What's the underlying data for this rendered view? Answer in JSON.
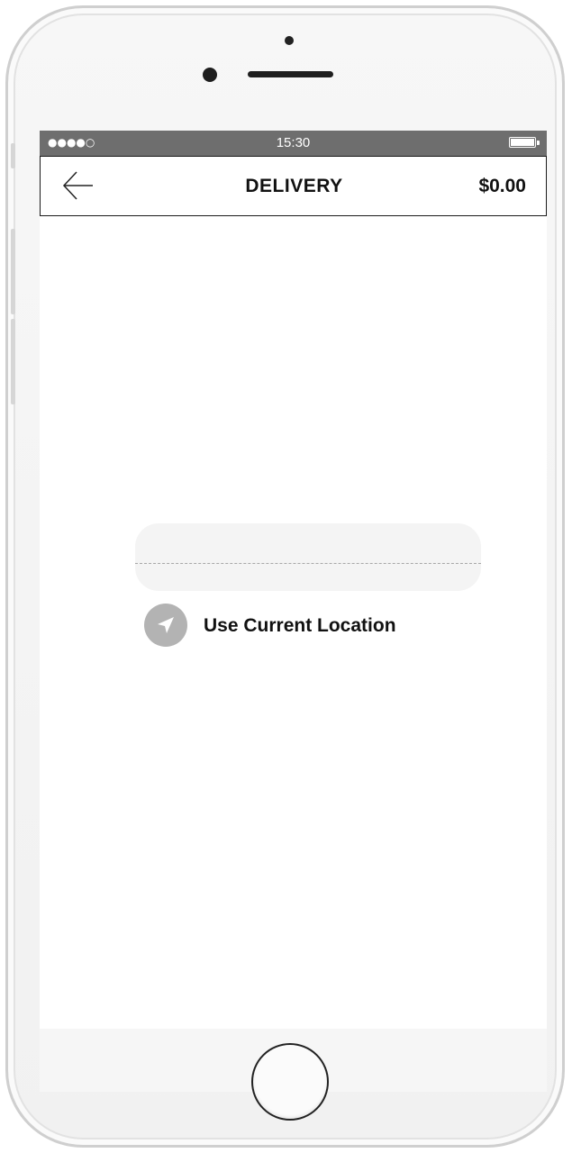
{
  "status_bar": {
    "signal": "●●●●○",
    "time": "15:30",
    "battery_icon": "battery-full-icon"
  },
  "nav": {
    "back_icon": "arrow-left-icon",
    "title": "DELIVERY",
    "price": "$0.00"
  },
  "address": {
    "value": "",
    "placeholder": ""
  },
  "location": {
    "icon": "navigation-arrow-icon",
    "label": "Use Current Location"
  },
  "colors": {
    "status_bar_bg": "#6e6e6e",
    "text": "#111111",
    "input_bg": "#f4f4f4",
    "location_icon_bg": "#b3b3b3"
  }
}
